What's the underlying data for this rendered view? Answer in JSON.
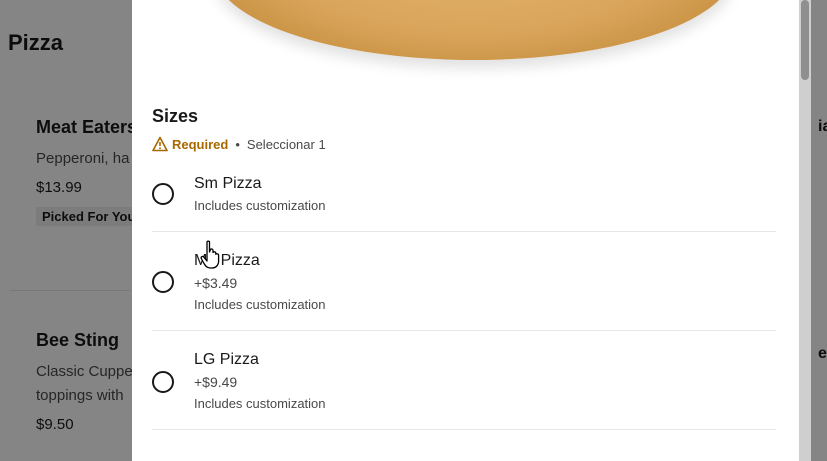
{
  "background": {
    "section_title": "Pizza",
    "items": [
      {
        "title": "Meat Eaters",
        "description": "Pepperoni, ha",
        "price": "$13.99",
        "badge": "Picked For You"
      },
      {
        "title": "Bee Sting",
        "description_line1": "Classic Cuppe",
        "description_line2": "toppings with",
        "price": "$9.50"
      }
    ],
    "right_column_fragments": [
      "ia",
      "e"
    ]
  },
  "modal": {
    "section_title": "Sizes",
    "required_label": "Required",
    "separator": "•",
    "select_hint": "Seleccionar 1",
    "options": [
      {
        "name": "Sm Pizza",
        "price": "",
        "note": "Includes customization",
        "selected": false
      },
      {
        "name": "Md Pizza",
        "price": "+$3.49",
        "note": "Includes customization",
        "selected": false
      },
      {
        "name": "LG Pizza",
        "price": "+$9.49",
        "note": "Includes customization",
        "selected": false
      }
    ]
  },
  "colors": {
    "warning": "#a86800",
    "text_primary": "#191919",
    "text_secondary": "#494949"
  }
}
